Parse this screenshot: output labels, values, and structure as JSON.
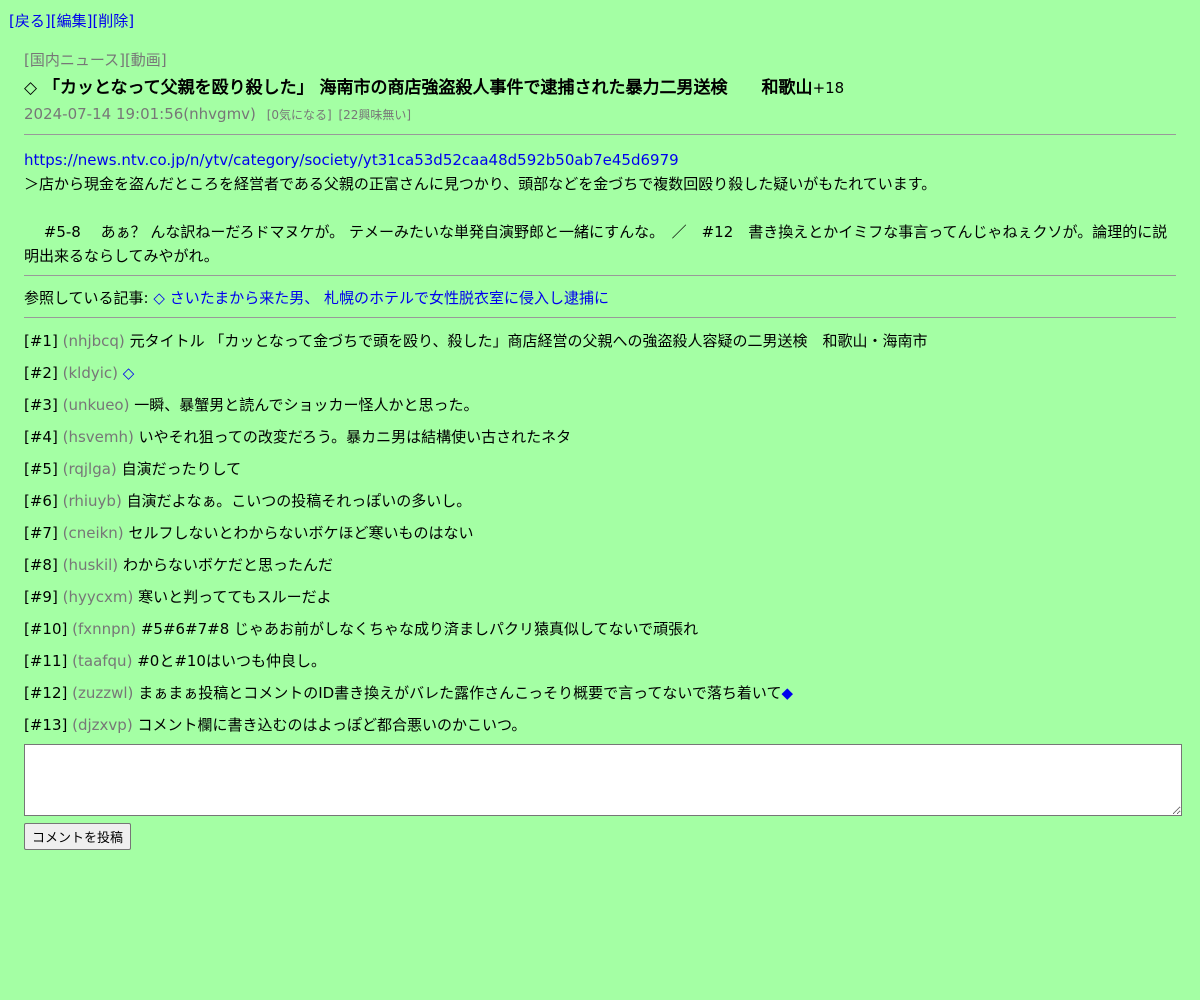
{
  "nav": {
    "back": "[戻る]",
    "edit": "[編集]",
    "delete": "[削除]"
  },
  "article": {
    "categories": "[国内ニュース][動画]",
    "title": "◇ 「カッとなって父親を殴り殺した」 海南市の商店強盗殺人事件で逮捕された暴力二男送検　　和歌山",
    "score": "+18",
    "datetime": "2024-07-14 19:01:56(nhvgmv)",
    "interest": "[0気になる]",
    "no_interest": "[22興味無い]",
    "url": "https://news.ntv.co.jp/n/ytv/category/society/yt31ca53d52caa48d592b50ab7e45d6979",
    "quote": "＞店から現金を盗んだところを経営者である父親の正富さんに見つかり、頭部などを金づちで複数回殴り殺した疑いがもたれています。",
    "note": "　 #5-8　 あぁ？ んな訳ねーだろドマヌケが。 テメーみたいな単発自演野郎と一緒にすんな。　／　#12　書き換えとかイミフな事言ってんじゃねぇクソが。論理的に説明出来るならしてみやがれ。",
    "ref_label": "参照している記事:",
    "ref_link": "◇ さいたまから来た男、 札幌のホテルで女性脱衣室に侵入し逮捕に"
  },
  "comments": [
    {
      "num": "[#1]",
      "uid": "(nhjbcq)",
      "text": "元タイトル 「カッとなって金づちで頭を殴り、殺した」商店経営の父親への強盗殺人容疑の二男送検　和歌山・海南市"
    },
    {
      "num": "[#2]",
      "uid": "(kldyic)",
      "text": "",
      "link": "◇"
    },
    {
      "num": "[#3]",
      "uid": "(unkueo)",
      "text": "一瞬、暴蟹男と読んでショッカー怪人かと思った。"
    },
    {
      "num": "[#4]",
      "uid": "(hsvemh)",
      "text": "いやそれ狙っての改変だろう。暴カニ男は結構使い古されたネタ"
    },
    {
      "num": "[#5]",
      "uid": "(rqjlga)",
      "text": "自演だったりして"
    },
    {
      "num": "[#6]",
      "uid": "(rhiuyb)",
      "text": "自演だよなぁ。こいつの投稿それっぽいの多いし。"
    },
    {
      "num": "[#7]",
      "uid": "(cneikn)",
      "text": "セルフしないとわからないボケほど寒いものはない"
    },
    {
      "num": "[#8]",
      "uid": "(huskil)",
      "text": "わからないボケだと思ったんだ"
    },
    {
      "num": "[#9]",
      "uid": "(hyycxm)",
      "text": "寒いと判っててもスルーだよ"
    },
    {
      "num": "[#10]",
      "uid": "(fxnnpn)",
      "text": "#5#6#7#8 じゃあお前がしなくちゃな成り済ましパクリ猿真似してないで頑張れ"
    },
    {
      "num": "[#11]",
      "uid": "(taafqu)",
      "text": "#0と#10はいつも仲良し。"
    },
    {
      "num": "[#12]",
      "uid": "(zuzzwl)",
      "text": "まぁまぁ投稿とコメントのID書き換えがバレた露作さんこっそり概要で言ってないで落ち着いて",
      "link": "◆"
    },
    {
      "num": "[#13]",
      "uid": "(djzxvp)",
      "text": "コメント欄に書き込むのはよっぽど都合悪いのかこいつ。"
    }
  ],
  "form": {
    "submit_label": "コメントを投稿",
    "textarea_value": ""
  },
  "colors": {
    "background": "#a4ffa4",
    "link": "#0000ee",
    "muted": "#777777"
  }
}
